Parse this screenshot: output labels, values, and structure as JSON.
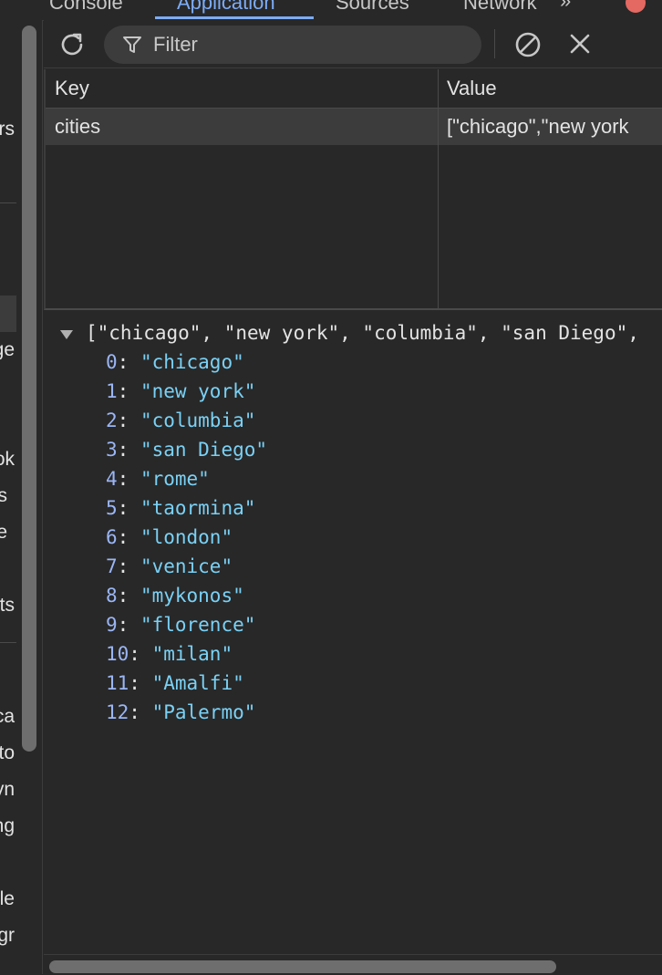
{
  "tabs": [
    "Console",
    "Application",
    "Sources",
    "Network"
  ],
  "tab_more": "»",
  "sidebar_fragments": [
    "rs",
    "ge",
    "ok",
    "s",
    "e",
    "ts",
    "ca",
    "to",
    "yn",
    "ng",
    "le",
    "gr"
  ],
  "toolbar": {
    "filter_placeholder": "Filter",
    "refresh_icon": "refresh-icon",
    "filter_icon": "filter-funnel-icon",
    "clear_all_icon": "block-icon",
    "delete_icon": "close-icon"
  },
  "table": {
    "headers": {
      "key": "Key",
      "value": "Value"
    },
    "rows": [
      {
        "key": "cities",
        "value": "[\"chicago\",\"new york"
      }
    ]
  },
  "preview": {
    "summary": "[\"chicago\", \"new york\", \"columbia\", \"san Diego\",",
    "items": [
      {
        "index": "0",
        "value": "\"chicago\""
      },
      {
        "index": "1",
        "value": "\"new york\""
      },
      {
        "index": "2",
        "value": "\"columbia\""
      },
      {
        "index": "3",
        "value": "\"san Diego\""
      },
      {
        "index": "4",
        "value": "\"rome\""
      },
      {
        "index": "5",
        "value": "\"taormina\""
      },
      {
        "index": "6",
        "value": "\"london\""
      },
      {
        "index": "7",
        "value": "\"venice\""
      },
      {
        "index": "8",
        "value": "\"mykonos\""
      },
      {
        "index": "9",
        "value": "\"florence\""
      },
      {
        "index": "10",
        "value": "\"milan\""
      },
      {
        "index": "11",
        "value": "\"Amalfi\""
      },
      {
        "index": "12",
        "value": "\"Palermo\""
      }
    ]
  },
  "colors": {
    "background": "#282828",
    "accent": "#7cacf8",
    "index": "#9bb6f5",
    "string": "#7ad1f5",
    "error": "#e46962"
  }
}
